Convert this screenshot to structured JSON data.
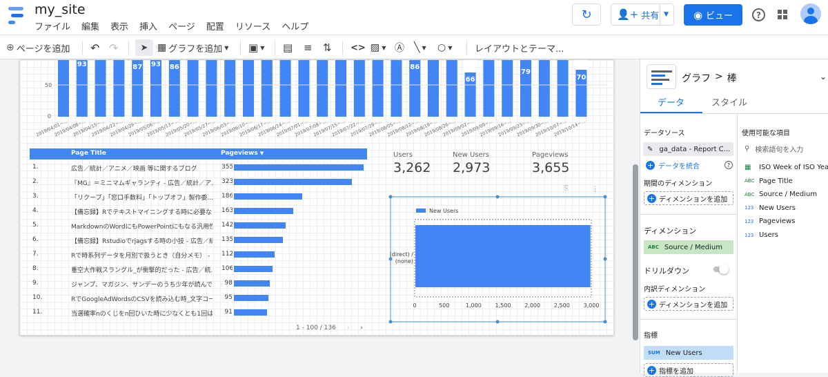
{
  "app": {
    "title": "my_site"
  },
  "menu": [
    "ファイル",
    "編集",
    "表示",
    "挿入",
    "ページ",
    "配置",
    "リソース",
    "ヘルプ"
  ],
  "header": {
    "share_label": "共有",
    "view_label": "ビュー"
  },
  "toolbar": {
    "add_page": "ページを追加",
    "add_chart": "グラフを追加",
    "layout_theme": "レイアウトとテーマ..."
  },
  "canvas": {
    "top_chart": {
      "categories": [
        "2019/04/01~...",
        "2019/04/08~...",
        "2019/04/15~...",
        "2019/04/22~...",
        "2019/04/29~...",
        "2019/05/06~...",
        "2019/05/13~...",
        "2019/05/20~...",
        "2019/05/27~...",
        "2019/06/03~...",
        "2019/06/10~...",
        "2019/06/17~...",
        "2019/06/24~...",
        "2019/07/01~...",
        "2019/07/08~...",
        "2019/07/15~...",
        "2019/07/22~...",
        "2019/07/29~...",
        "2019/08/05~...",
        "2019/08/12~...",
        "2019/08/19~...",
        "2019/08/26~...",
        "2019/09/02~...",
        "2019/09/09~...",
        "2019/09/16~...",
        "2019/09/23~...",
        "2019/09/30~...",
        "2019/10/07~...",
        "2019/10/14~..."
      ],
      "labeled": [
        {
          "index": 1,
          "value": "93"
        },
        {
          "index": 4,
          "value": "87"
        },
        {
          "index": 5,
          "value": "93"
        },
        {
          "index": 6,
          "value": "86"
        },
        {
          "index": 19,
          "value": "86"
        },
        {
          "index": 22,
          "value": "66"
        },
        {
          "index": 25,
          "value": "79"
        },
        {
          "index": 28,
          "value": "70"
        }
      ],
      "y_tick_50": "50",
      "y_tick_0": "0"
    },
    "table": {
      "headers": {
        "title": "Page Title",
        "pageviews": "Pageviews"
      },
      "rows": [
        {
          "num": "1.",
          "title": "広告／統計／アニメ／映画 等に関するブログ",
          "value": 355
        },
        {
          "num": "2.",
          "title": "『MG』＝ミニマムギャランティ - 広告／統計／ア...",
          "value": 323
        },
        {
          "num": "3.",
          "title": "「リクープ」「窓口手数料」「トップオフ」製作委...",
          "value": 186
        },
        {
          "num": "4.",
          "title": "【備忘録】Rでテキストマイニングする時に必要な...",
          "value": 163
        },
        {
          "num": "5.",
          "title": "MarkdownのWordにもPowerPointにもなる汎用性の...",
          "value": 142
        },
        {
          "num": "6.",
          "title": "【備忘録】Rstudioでrjagsする時の小技 - 広告／統...",
          "value": 135
        },
        {
          "num": "7.",
          "title": "Rで時系列データを月別で扱うとき（自分メモ） - ...",
          "value": 112
        },
        {
          "num": "8.",
          "title": "垂空大作戦スラングル_が衝撃的だった - 広告／統...",
          "value": 106
        },
        {
          "num": "9.",
          "title": "ジャンプ、マガジン、サンデーのうち少年が読んで...",
          "value": 98
        },
        {
          "num": "10.",
          "title": "RでGoogleAdWordsのCSVを読み込む時_文字コード...",
          "value": 95
        },
        {
          "num": "11.",
          "title": "当選確率nのくじをn回ひいた時に少なくとも1回は...",
          "value": 91
        }
      ],
      "pagination": "1 - 100 / 136"
    },
    "scorecards": [
      {
        "label": "Users",
        "value": "3,262"
      },
      {
        "label": "New Users",
        "value": "2,973"
      },
      {
        "label": "Pageviews",
        "value": "3,655"
      }
    ]
  },
  "chart_data": {
    "type": "bar",
    "orientation": "horizontal",
    "categories": [
      "(direct) / (none)"
    ],
    "series": [
      {
        "name": "New Users",
        "values": [
          2973
        ]
      }
    ],
    "xlim": [
      0,
      3000
    ],
    "x_ticks": [
      "0",
      "500",
      "1,000",
      "1,500",
      "2,000",
      "2,500",
      "3,000"
    ],
    "legend": "top"
  },
  "panel": {
    "breadcrumb": {
      "a": "グラフ",
      "sep": ">",
      "b": "棒"
    },
    "tabs": {
      "data": "データ",
      "style": "スタイル"
    },
    "data_source_label": "データソース",
    "data_source_value": "ga_data - Report C...",
    "blend_label": "データを統合",
    "period_dimension": "期間のディメンション",
    "add_dimension": "ディメンションを追加",
    "dimension_label": "ディメンション",
    "dimension_value": "Source / Medium",
    "drilldown": "ドリルダウン",
    "breakdown": "内訳ディメンション",
    "metric_label": "指標",
    "metric_value": "New Users",
    "add_metric": "指標を追加",
    "available_fields": "使用可能な項目",
    "search_placeholder": "検索語句を入力",
    "fields": [
      {
        "type": "date",
        "name": "ISO Week of ISO Year"
      },
      {
        "type": "ABC",
        "name": "Page Title"
      },
      {
        "type": "ABC",
        "name": "Source / Medium"
      },
      {
        "type": "123",
        "name": "New Users"
      },
      {
        "type": "123",
        "name": "Pageviews"
      },
      {
        "type": "123",
        "name": "Users"
      }
    ]
  },
  "colors": {
    "accent": "#1a73e8",
    "bar": "#4285f4",
    "selected": "#c6e6c4",
    "metric": "#c2ddf7"
  }
}
